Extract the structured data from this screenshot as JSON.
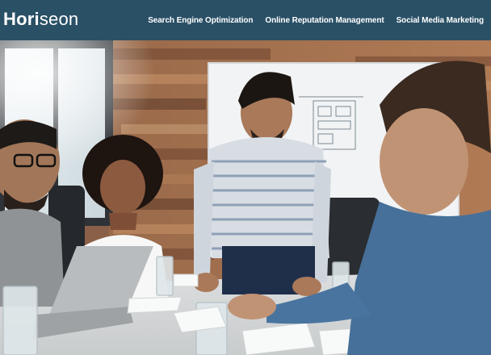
{
  "header": {
    "logo": {
      "bold": "Hori",
      "light": "seon"
    },
    "nav": [
      {
        "label": "Search Engine Optimization"
      },
      {
        "label": "Online Reputation Management"
      },
      {
        "label": "Social Media Marketing"
      }
    ]
  },
  "hero": {
    "icon": "hero-photo-team-meeting"
  },
  "colors": {
    "header_bg": "#2a5066",
    "header_text": "#ffffff"
  }
}
